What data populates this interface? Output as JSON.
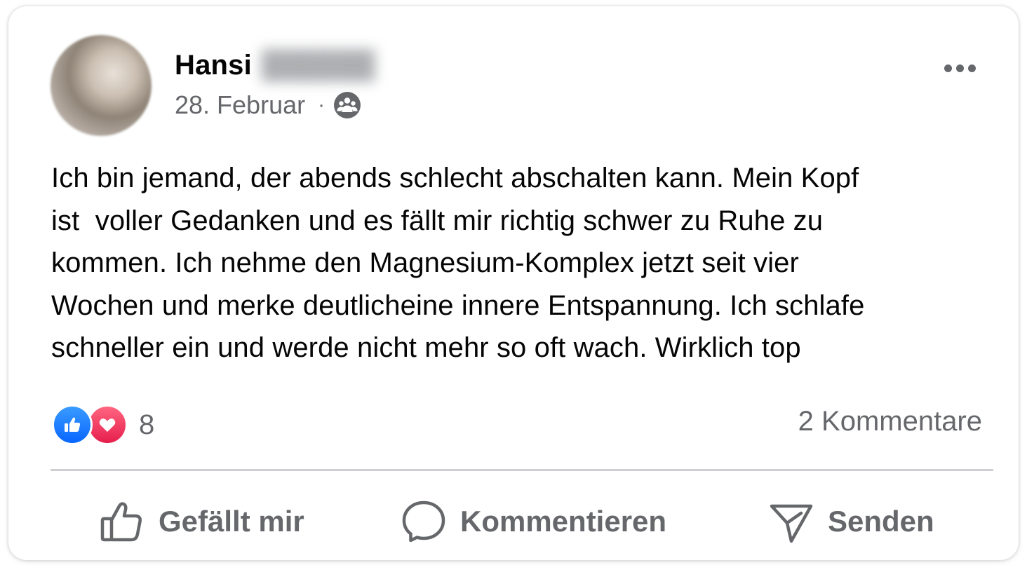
{
  "post": {
    "author_first_name": "Hansi",
    "date": "28. Februar",
    "separator": "·",
    "privacy_icon": "group-icon",
    "more_icon": "more-horizontal-icon",
    "text": "Ich bin jemand, der abends schlecht abschalten kann. Mein Kopf\nist  voller Gedanken und es fällt mir richtig schwer zu Ruhe zu\nkommen. Ich nehme den Magnesium-Komplex jetzt seit vier\nWochen und merke deutlicheine innere Entspannung. Ich schlafe\nschneller ein und werde nicht mehr so oft wach. Wirklich top"
  },
  "stats": {
    "reaction_icons": [
      "like-icon",
      "love-icon"
    ],
    "reaction_count": "8",
    "comments": "2 Kommentare"
  },
  "actions": {
    "like_label": "Gefällt mir",
    "comment_label": "Kommentieren",
    "send_label": "Senden"
  },
  "colors": {
    "text_primary": "#050505",
    "text_secondary": "#65676b",
    "like_blue": "#0866ff",
    "love_red": "#e61e4d",
    "divider": "#ced0d4"
  }
}
